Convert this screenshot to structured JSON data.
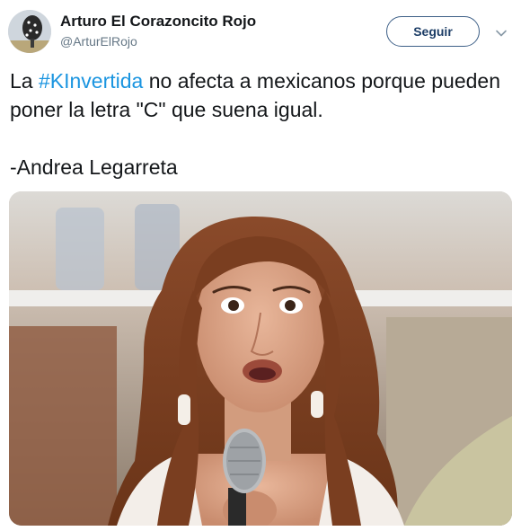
{
  "author": {
    "display_name": "Arturo El Corazoncito Rojo",
    "handle": "@ArturElRojo",
    "avatar_icon": "avatar-image"
  },
  "follow_button": {
    "label": "Seguir"
  },
  "more_menu": {
    "icon": "chevron-down-icon"
  },
  "tweet": {
    "text_before": "La ",
    "hashtag": "#KInvertida",
    "text_after": " no afecta a mexicanos porque pueden poner la letra \"C\" que suena igual.",
    "signature": "-Andrea Legarreta"
  },
  "media": {
    "kind": "photo",
    "subject": "woman-speaking-into-microphone"
  },
  "colors": {
    "hashtag": "#1b95e0",
    "button_border": "#3d5f87",
    "handle_text": "#657786"
  }
}
